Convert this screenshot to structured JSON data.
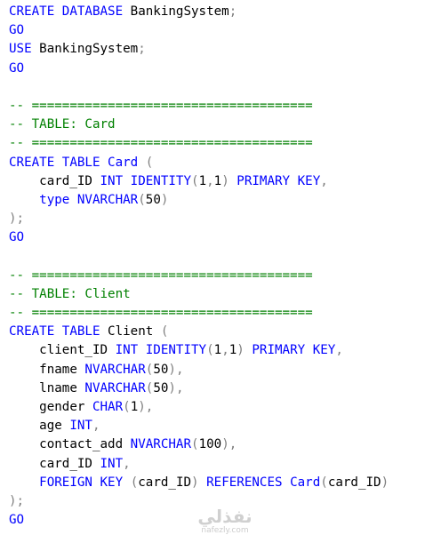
{
  "code": {
    "lines": [
      {
        "tokens": [
          [
            "kw",
            "CREATE DATABASE"
          ],
          [
            "id",
            " BankingSystem"
          ],
          [
            "gray",
            ";"
          ]
        ]
      },
      {
        "tokens": [
          [
            "kw",
            "GO"
          ]
        ]
      },
      {
        "tokens": [
          [
            "kw",
            "USE"
          ],
          [
            "id",
            " BankingSystem"
          ],
          [
            "gray",
            ";"
          ]
        ]
      },
      {
        "tokens": [
          [
            "kw",
            "GO"
          ]
        ]
      },
      {
        "tokens": []
      },
      {
        "tokens": [
          [
            "cm",
            "-- ====================================="
          ]
        ]
      },
      {
        "tokens": [
          [
            "cm",
            "-- TABLE: Card"
          ]
        ]
      },
      {
        "tokens": [
          [
            "cm",
            "-- ====================================="
          ]
        ]
      },
      {
        "tokens": [
          [
            "kw",
            "CREATE TABLE"
          ],
          [
            "id",
            " "
          ],
          [
            "tb",
            "Card"
          ],
          [
            "id",
            " "
          ],
          [
            "gray",
            "("
          ]
        ]
      },
      {
        "tokens": [
          [
            "id",
            "    card_ID "
          ],
          [
            "ty",
            "INT"
          ],
          [
            "id",
            " "
          ],
          [
            "kw",
            "IDENTITY"
          ],
          [
            "gray",
            "("
          ],
          [
            "id",
            "1"
          ],
          [
            "gray",
            ","
          ],
          [
            "id",
            "1"
          ],
          [
            "gray",
            ")"
          ],
          [
            "id",
            " "
          ],
          [
            "kw",
            "PRIMARY KEY"
          ],
          [
            "gray",
            ","
          ]
        ]
      },
      {
        "tokens": [
          [
            "id",
            "    "
          ],
          [
            "kw",
            "type"
          ],
          [
            "id",
            " "
          ],
          [
            "ty",
            "NVARCHAR"
          ],
          [
            "gray",
            "("
          ],
          [
            "id",
            "50"
          ],
          [
            "gray",
            ")"
          ]
        ]
      },
      {
        "tokens": [
          [
            "gray",
            ");"
          ]
        ]
      },
      {
        "tokens": [
          [
            "kw",
            "GO"
          ]
        ]
      },
      {
        "tokens": []
      },
      {
        "tokens": [
          [
            "cm",
            "-- ====================================="
          ]
        ]
      },
      {
        "tokens": [
          [
            "cm",
            "-- TABLE: Client"
          ]
        ]
      },
      {
        "tokens": [
          [
            "cm",
            "-- ====================================="
          ]
        ]
      },
      {
        "tokens": [
          [
            "kw",
            "CREATE TABLE"
          ],
          [
            "id",
            " Client "
          ],
          [
            "gray",
            "("
          ]
        ]
      },
      {
        "tokens": [
          [
            "id",
            "    client_ID "
          ],
          [
            "ty",
            "INT"
          ],
          [
            "id",
            " "
          ],
          [
            "kw",
            "IDENTITY"
          ],
          [
            "gray",
            "("
          ],
          [
            "id",
            "1"
          ],
          [
            "gray",
            ","
          ],
          [
            "id",
            "1"
          ],
          [
            "gray",
            ")"
          ],
          [
            "id",
            " "
          ],
          [
            "kw",
            "PRIMARY KEY"
          ],
          [
            "gray",
            ","
          ]
        ]
      },
      {
        "tokens": [
          [
            "id",
            "    fname "
          ],
          [
            "ty",
            "NVARCHAR"
          ],
          [
            "gray",
            "("
          ],
          [
            "id",
            "50"
          ],
          [
            "gray",
            "),"
          ]
        ]
      },
      {
        "tokens": [
          [
            "id",
            "    lname "
          ],
          [
            "ty",
            "NVARCHAR"
          ],
          [
            "gray",
            "("
          ],
          [
            "id",
            "50"
          ],
          [
            "gray",
            "),"
          ]
        ]
      },
      {
        "tokens": [
          [
            "id",
            "    gender "
          ],
          [
            "ty",
            "CHAR"
          ],
          [
            "gray",
            "("
          ],
          [
            "id",
            "1"
          ],
          [
            "gray",
            "),"
          ]
        ]
      },
      {
        "tokens": [
          [
            "id",
            "    age "
          ],
          [
            "ty",
            "INT"
          ],
          [
            "gray",
            ","
          ]
        ]
      },
      {
        "tokens": [
          [
            "id",
            "    contact_add "
          ],
          [
            "ty",
            "NVARCHAR"
          ],
          [
            "gray",
            "("
          ],
          [
            "id",
            "100"
          ],
          [
            "gray",
            "),"
          ]
        ]
      },
      {
        "tokens": [
          [
            "id",
            "    card_ID "
          ],
          [
            "ty",
            "INT"
          ],
          [
            "gray",
            ","
          ]
        ]
      },
      {
        "tokens": [
          [
            "id",
            "    "
          ],
          [
            "kw",
            "FOREIGN KEY"
          ],
          [
            "id",
            " "
          ],
          [
            "gray",
            "("
          ],
          [
            "id",
            "card_ID"
          ],
          [
            "gray",
            ")"
          ],
          [
            "id",
            " "
          ],
          [
            "kw",
            "REFERENCES"
          ],
          [
            "id",
            " "
          ],
          [
            "tb",
            "Card"
          ],
          [
            "gray",
            "("
          ],
          [
            "id",
            "card_ID"
          ],
          [
            "gray",
            ")"
          ]
        ]
      },
      {
        "tokens": [
          [
            "gray",
            ");"
          ]
        ]
      },
      {
        "tokens": [
          [
            "kw",
            "GO"
          ]
        ]
      }
    ]
  },
  "watermark": {
    "main": "نفذلي",
    "sub": "nafezly.com"
  }
}
